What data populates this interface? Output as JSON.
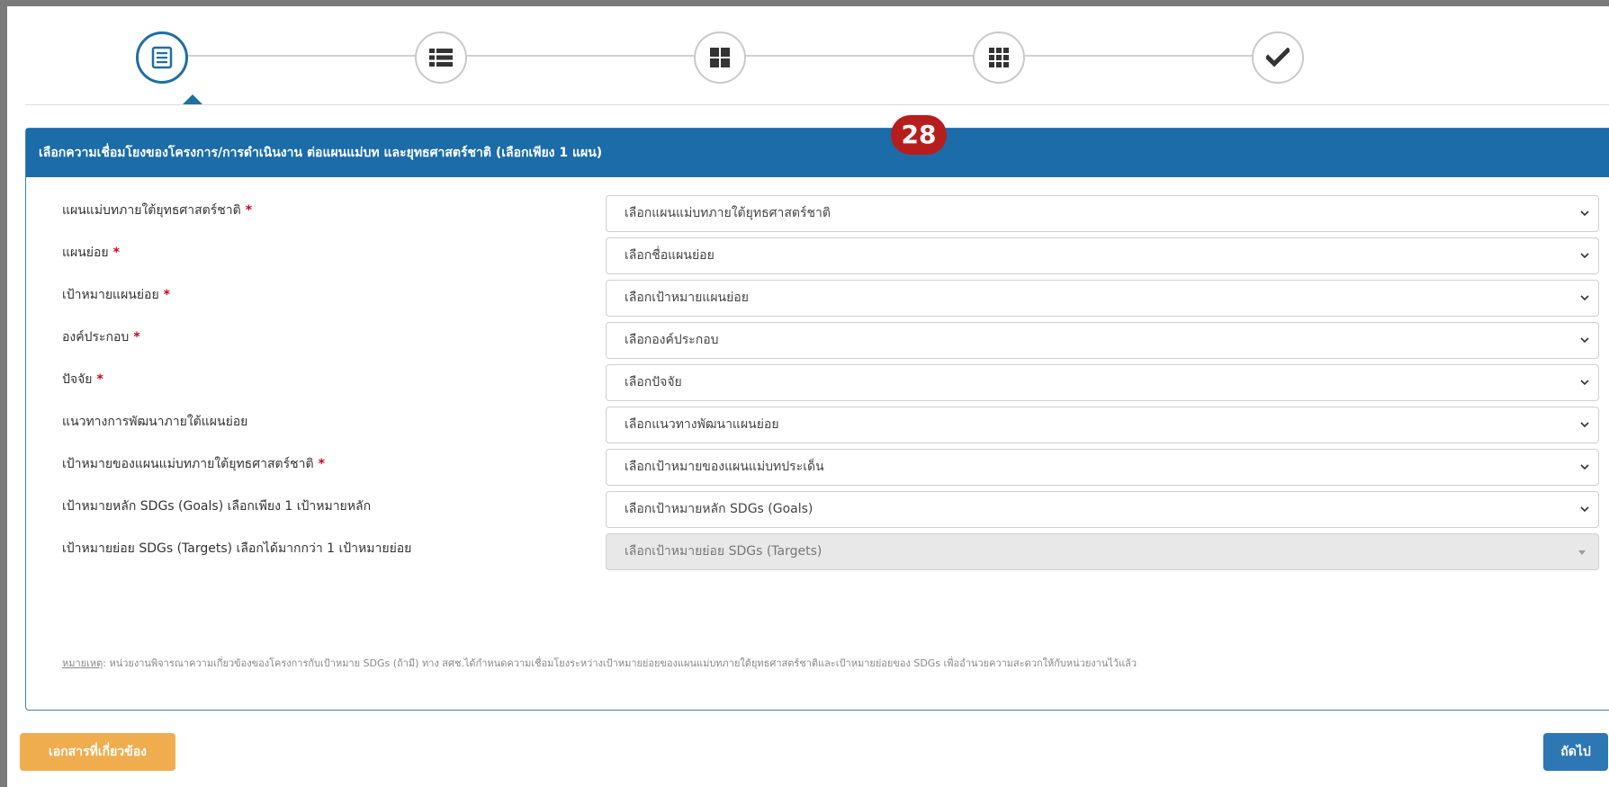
{
  "stepper": {
    "steps": [
      {
        "icon": "form-list-icon",
        "active": true
      },
      {
        "icon": "list-icon",
        "active": false
      },
      {
        "icon": "grid-large-icon",
        "active": false
      },
      {
        "icon": "grid-small-icon",
        "active": false
      },
      {
        "icon": "check-icon",
        "active": false
      }
    ]
  },
  "annotation": {
    "number": "28"
  },
  "panel": {
    "title": "เลือกความเชื่อมโยงของโครงการ/การดำเนินงาน ต่อแผนแม่บท และยุทธศาสตร์ชาติ (เลือกเพียง 1 แผน)"
  },
  "form": {
    "fields": [
      {
        "label": "แผนแม่บทภายใต้ยุทธศาสตร์ชาติ",
        "required": true,
        "placeholder": "เลือกแผนแม่บทภายใต้ยุทธศาสตร์ชาติ",
        "disabled": false
      },
      {
        "label": "แผนย่อย",
        "required": true,
        "placeholder": "เลือกชื่อแผนย่อย",
        "disabled": false
      },
      {
        "label": "เป้าหมายแผนย่อย",
        "required": true,
        "placeholder": "เลือกเป้าหมายแผนย่อย",
        "disabled": false
      },
      {
        "label": "องค์ประกอบ",
        "required": true,
        "placeholder": "เลือกองค์ประกอบ",
        "disabled": false
      },
      {
        "label": "ปัจจัย",
        "required": true,
        "placeholder": "เลือกปัจจัย",
        "disabled": false
      },
      {
        "label": "แนวทางการพัฒนาภายใต้แผนย่อย",
        "required": false,
        "placeholder": "เลือกแนวทางพัฒนาแผนย่อย",
        "disabled": false
      },
      {
        "label": "เป้าหมายของแผนแม่บทภายใต้ยุทธศาสตร์ชาติ",
        "required": true,
        "placeholder": "เลือกเป้าหมายของแผนแม่บทประเด็น",
        "disabled": false
      },
      {
        "label": "เป้าหมายหลัก SDGs (Goals) เลือกเพียง 1 เป้าหมายหลัก",
        "required": false,
        "placeholder": "เลือกเป้าหมายหลัก SDGs (Goals)",
        "disabled": false
      },
      {
        "label": "เป้าหมายย่อย SDGs (Targets) เลือกได้มากกว่า 1 เป้าหมายย่อย",
        "required": false,
        "placeholder": "เลือกเป้าหมายย่อย SDGs (Targets)",
        "disabled": true
      }
    ],
    "required_mark": "*",
    "note_prefix": "หมายเหตุ",
    "note_text": ": หน่วยงานพิจารณาความเกี่ยวข้องของโครงการกับเป้าหมาย SDGs (ถ้ามี) ทาง สศช.ได้กำหนดความเชื่อมโยงระหว่างเป้าหมายย่อยของแผนแม่บทภายใต้ยุทธศาสตร์ชาติและเป้าหมายย่อยของ SDGs เพื่ออำนวยความสะดวกให้กับหน่วยงานไว้แล้ว"
  },
  "buttons": {
    "related_docs": "เอกสารที่เกี่ยวข้อง",
    "next": "ถัดไป"
  },
  "colors": {
    "header": "#1b6ca8",
    "active_step": "#1f6ea5",
    "badge": "#b81d1d",
    "docs_button": "#f0ad4e",
    "next_button": "#2d77b5",
    "required": "#d0021b"
  }
}
